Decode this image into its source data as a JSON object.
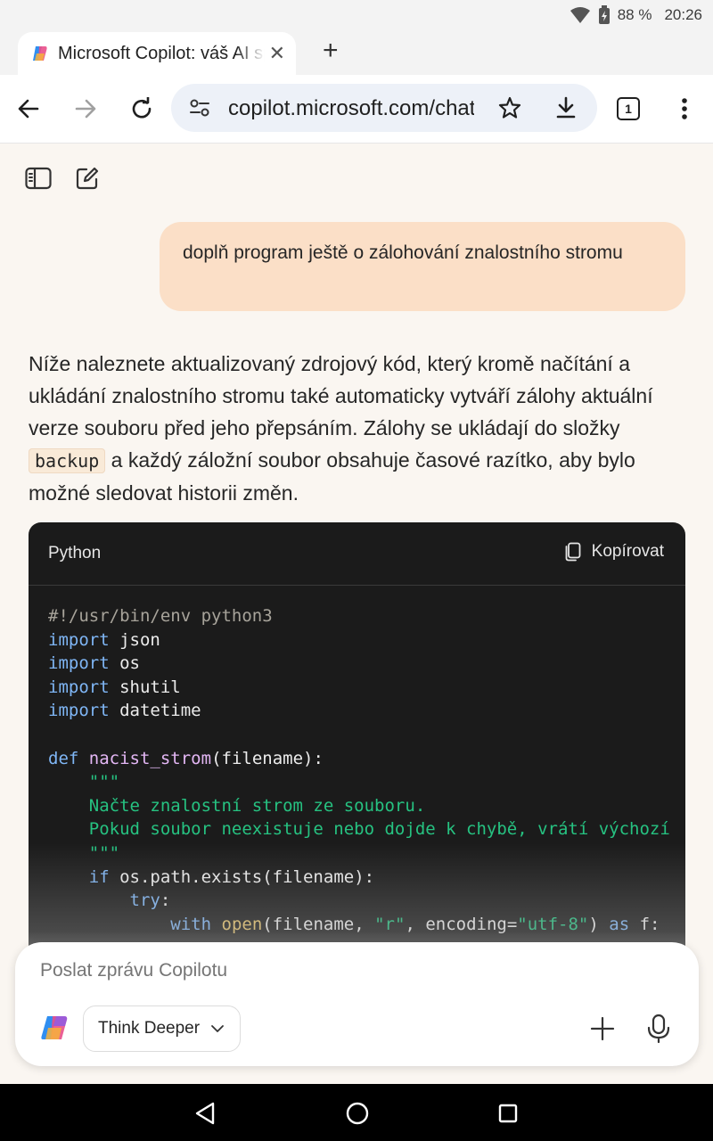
{
  "status": {
    "battery": "88 %",
    "time": "20:26"
  },
  "tab": {
    "title": "Microsoft Copilot: váš AI společník",
    "close": "✕",
    "new_tab": "+"
  },
  "toolbar": {
    "url": "copilot.microsoft.com/chats",
    "tab_count": "1"
  },
  "chat": {
    "user_message": "doplň program ještě o zálohování znalostního stromu",
    "reply_part1": "Níže naleznete aktualizovaný zdrojový kód, který kromě načítání a ukládání znalostního stromu také automaticky vytváří zálohy aktuální verze souboru před jeho přepsáním. Zálohy se ukládají do složky ",
    "reply_code": "backup",
    "reply_part2": " a každý záložní soubor obsahuje časové razítko, aby bylo možné sledovat historii změn.",
    "code": {
      "language": "Python",
      "copy_label": "Kopírovat",
      "tokens": {
        "shebang": "#!/usr/bin/env python3",
        "kw_import": "import",
        "mod_json": "json",
        "mod_os": "os",
        "mod_shutil": "shutil",
        "mod_datetime": "datetime",
        "kw_def": "def",
        "fn_name": "nacist_strom",
        "fn_params": "(filename):",
        "docq": "\"\"\"",
        "doc1": "Načte znalostní strom ze souboru.",
        "doc2": "Pokud soubor neexistuje nebo dojde k chybě, vrátí výchozí",
        "kw_if": "if",
        "if_rest": " os.path.exists(filename):",
        "kw_try": "try",
        "colon": ":",
        "kw_with": "with",
        "bi_open": "open",
        "open_a": "(filename, ",
        "str_r": "\"r\"",
        "open_b": ", encoding=",
        "str_utf8": "\"utf-8\"",
        "open_c": ") ",
        "kw_as": "as",
        "open_d": " f:"
      }
    }
  },
  "composer": {
    "placeholder": "Poslat zprávu Copilotu",
    "mode_label": "Think Deeper"
  },
  "colors": {
    "user_bubble": "#fbdfc7",
    "code_bg": "#1b1b1b",
    "page_bg": "#faf6f1"
  }
}
